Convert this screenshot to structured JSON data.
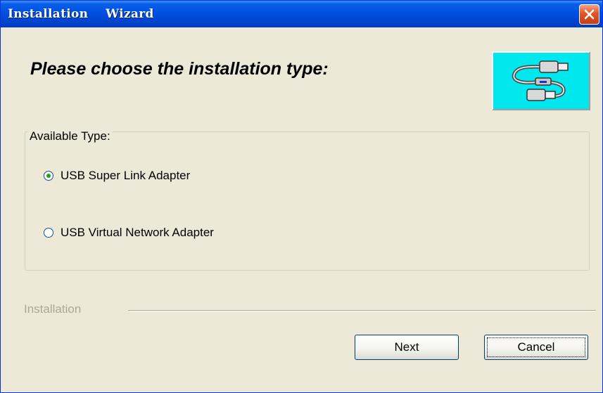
{
  "window": {
    "title": "Installation    Wizard",
    "colors": {
      "titlebar": "#0055e5",
      "close_button": "#e35428",
      "background": "#ece9d8",
      "logo_background": "#00e8ee"
    }
  },
  "header": {
    "heading": "Please choose the installation type:",
    "logo_icon": "usb-cable-icon"
  },
  "type_group": {
    "label": "Available Type:",
    "options": [
      {
        "label": "USB Super Link Adapter",
        "selected": true
      },
      {
        "label": "USB Virtual Network Adapter",
        "selected": false
      }
    ]
  },
  "installation_section": {
    "label": "Installation"
  },
  "buttons": {
    "next": "Next",
    "cancel": "Cancel"
  }
}
